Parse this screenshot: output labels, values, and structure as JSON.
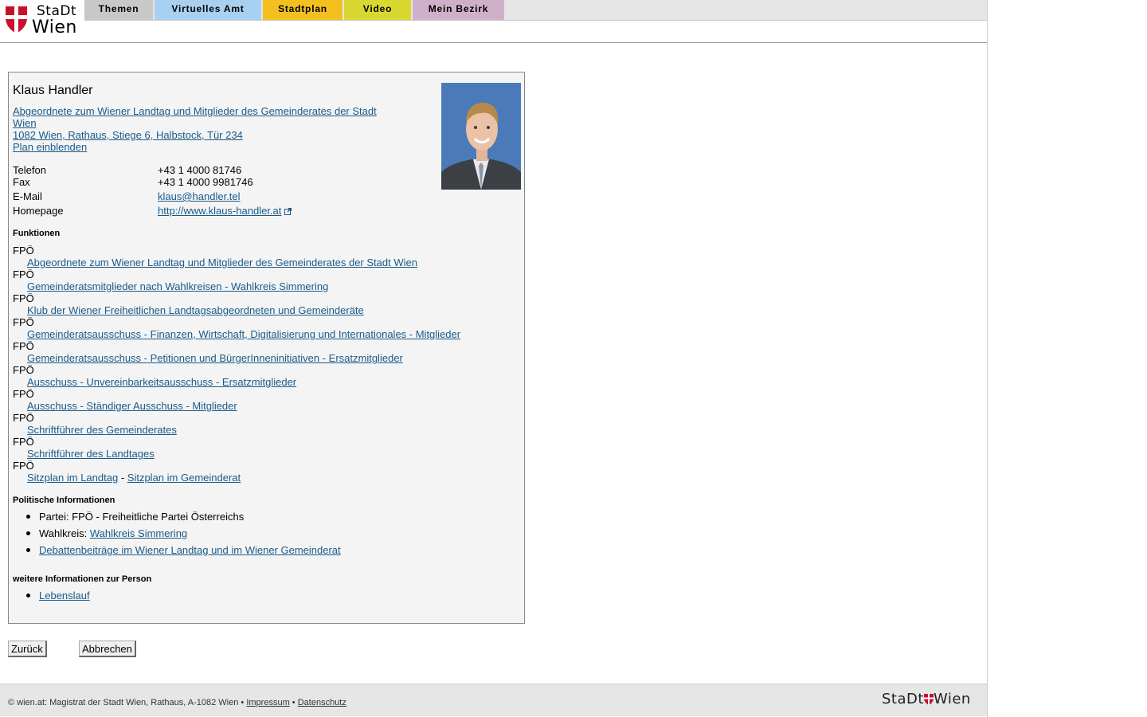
{
  "logo": {
    "line1": "StaDt",
    "line2": "Wien"
  },
  "nav": [
    {
      "label": "Themen",
      "color": "#c8c8c8"
    },
    {
      "label": "Virtuelles Amt",
      "color": "#a8d0f0"
    },
    {
      "label": "Stadtplan",
      "color": "#f4c020"
    },
    {
      "label": "Video",
      "color": "#d8d830"
    },
    {
      "label": "Mein Bezirk",
      "color": "#d0b0c8"
    }
  ],
  "person": {
    "name": "Klaus Handler",
    "role_line1": "Abgeordnete zum Wiener Landtag und Mitglieder des Gemeinderates der Stadt",
    "role_line2": "Wien",
    "address": "1082 Wien, Rathaus, Stiege 6, Halbstock, Tür 234",
    "plan_link": "Plan einblenden"
  },
  "contact": {
    "phone_label": "Telefon",
    "phone": "+43 1 4000 81746",
    "fax_label": "Fax",
    "fax": "+43 1 4000 9981746",
    "email_label": "E-Mail",
    "email": "klaus@handler.tel",
    "homepage_label": "Homepage",
    "homepage": "http://www.klaus-handler.at"
  },
  "functions": {
    "heading": "Funktionen",
    "items": [
      {
        "party": "FPÖ",
        "link": "Abgeordnete zum Wiener Landtag und Mitglieder des Gemeinderates der Stadt Wien"
      },
      {
        "party": "FPÖ",
        "link": "Gemeinderatsmitglieder nach Wahlkreisen - Wahlkreis Simmering"
      },
      {
        "party": "FPÖ",
        "link": "Klub der Wiener Freiheitlichen Landtagsabgeordneten und Gemeinderäte"
      },
      {
        "party": "FPÖ",
        "link": "Gemeinderatsausschuss - Finanzen, Wirtschaft, Digitalisierung und Internationales - Mitglieder"
      },
      {
        "party": "FPÖ",
        "link": "Gemeinderatsausschuss - Petitionen und BürgerInneninitiativen - Ersatzmitglieder"
      },
      {
        "party": "FPÖ",
        "link": "Ausschuss - Unvereinbarkeitsausschuss - Ersatzmitglieder"
      },
      {
        "party": "FPÖ",
        "link": "Ausschuss - Ständiger Ausschuss - Mitglieder"
      },
      {
        "party": "FPÖ",
        "link": "Schriftführer des Gemeinderates"
      },
      {
        "party": "FPÖ",
        "link": "Schriftführer des Landtages"
      },
      {
        "party": "FPÖ",
        "link": "Sitzplan im Landtag",
        "separator": "-",
        "link2": "Sitzplan im Gemeinderat"
      }
    ]
  },
  "political": {
    "heading": "Politische Informationen",
    "party": "Partei: FPÖ - Freiheitliche Partei Österreichs",
    "district_label": "Wahlkreis:",
    "district_link": "Wahlkreis Simmering",
    "debates_link": "Debattenbeiträge im Wiener Landtag und im Wiener Gemeinderat"
  },
  "more": {
    "heading": "weitere Informationen zur Person",
    "cv_link": "Lebenslauf"
  },
  "buttons": {
    "back": "Zurück",
    "cancel": "Abbrechen"
  },
  "footer": {
    "copyright": "© wien.at: Magistrat der Stadt Wien, Rathaus, A-1082 Wien •",
    "impressum": "Impressum",
    "sep": "•",
    "datenschutz": "Datenschutz",
    "logo_left": "StaDt",
    "logo_right": "Wien"
  }
}
